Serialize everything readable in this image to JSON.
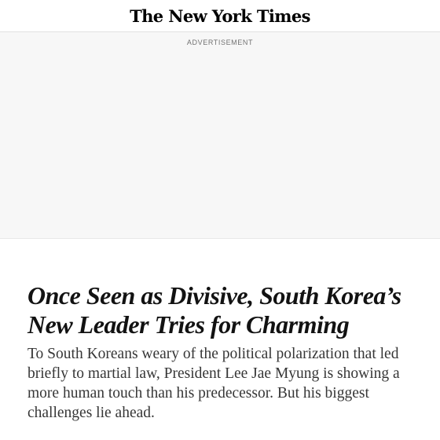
{
  "masthead": {
    "logo_text": "The New York Times"
  },
  "ad": {
    "label": "ADVERTISEMENT"
  },
  "article": {
    "headline": "Once Seen as Divisive, South Korea’s New Leader Tries for Charming",
    "summary": "To South Koreans weary of the political polarization that led briefly to martial law, President Lee Jae Myung is showing a more human touch than his predecessor. But his biggest challenges lie ahead."
  }
}
